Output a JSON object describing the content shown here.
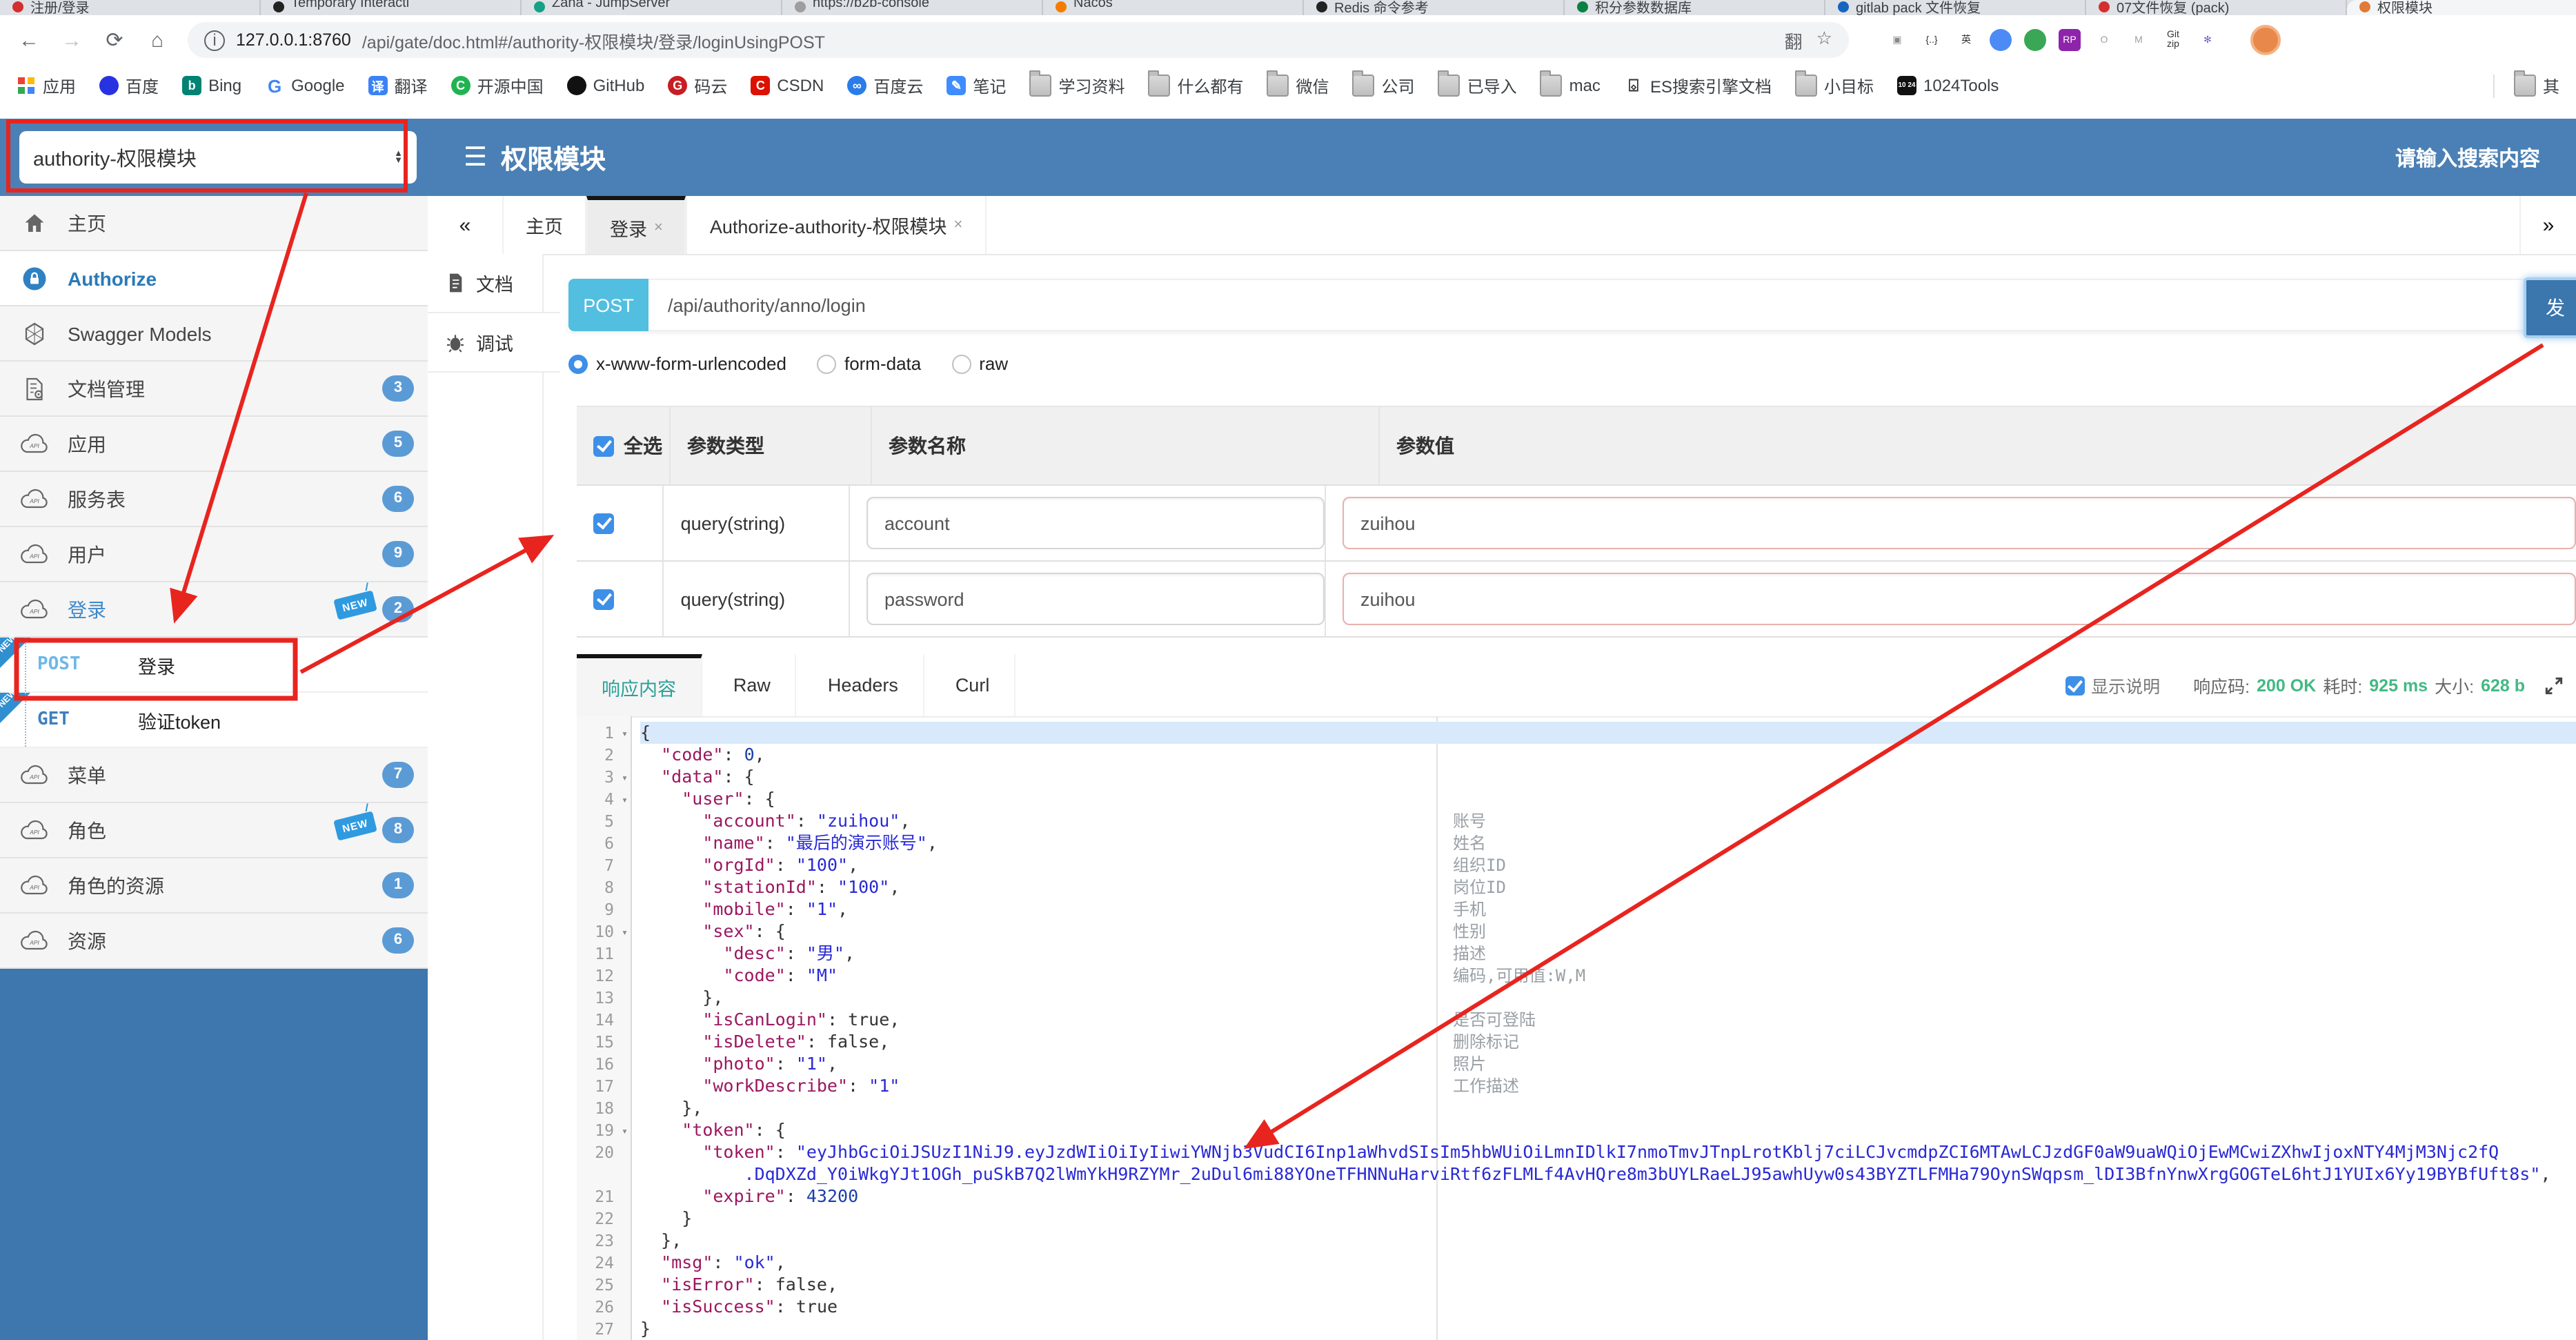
{
  "browser": {
    "tabs": [
      {
        "title": "注册/登录",
        "color": "#d32f2f"
      },
      {
        "title": "Temporary Interacti",
        "color": "#222222"
      },
      {
        "title": "Zana - JumpServer",
        "color": "#16a085"
      },
      {
        "title": "https://b2b-console",
        "color": "#9e9e9e"
      },
      {
        "title": "Nacos",
        "color": "#f57c00"
      },
      {
        "title": "Redis 命令参考",
        "color": "#222222"
      },
      {
        "title": "积分参数数据库",
        "color": "#0a8043"
      },
      {
        "title": "gitlab pack 文件恢复",
        "color": "#1565c0"
      },
      {
        "title": "07文件恢复 (pack)",
        "color": "#d32f2f"
      },
      {
        "title": "权限模块",
        "color": "#e07b39",
        "active": true
      }
    ],
    "nav": {
      "back": "←",
      "forward": "→",
      "reload": "⟳",
      "home": "⌂"
    },
    "url_host": "127.0.0.1:8760",
    "url_path": "/api/gate/doc.html#/authority-权限模块/登录/loginUsingPOST",
    "pill_icons": {
      "translate": "翻",
      "star": "☆"
    },
    "extensions": [
      {
        "name": "page-extension-icon",
        "glyph": "▣",
        "bg": "#ffffff",
        "fg": "#888888"
      },
      {
        "name": "brackets-extension-icon",
        "glyph": "{..}",
        "bg": "#ffffff",
        "fg": "#333333"
      },
      {
        "name": "translate-en-extension-icon",
        "glyph": "英",
        "bg": "#ffffff",
        "fg": "#333333"
      },
      {
        "name": "chrome-extension-icon",
        "glyph": "",
        "bg": "#4c8bf5",
        "fg": "#ffffff"
      },
      {
        "name": "globe-extension-icon",
        "glyph": "",
        "bg": "#3aa757",
        "fg": "#ffffff"
      },
      {
        "name": "rp-extension-icon",
        "glyph": "RP",
        "bg": "#8e24aa",
        "fg": "#ffffff"
      },
      {
        "name": "ring-extension-icon",
        "glyph": "O",
        "bg": "#ffffff",
        "fg": "#9e9e9e"
      },
      {
        "name": "down-arrow-extension-icon",
        "glyph": "M",
        "bg": "#ffffff",
        "fg": "#9e9e9e"
      },
      {
        "name": "gitzip-extension-icon",
        "glyph": "Git\nzip",
        "bg": "#ffffff",
        "fg": "#333333"
      },
      {
        "name": "pinwheel-extension-icon",
        "glyph": "✻",
        "bg": "#ffffff",
        "fg": "#7b61c4"
      }
    ],
    "bookmarks": [
      {
        "label": "应用",
        "icon": "grid"
      },
      {
        "label": "百度",
        "icon": "circle",
        "color": "#2932e1",
        "glyph": ""
      },
      {
        "label": "Bing",
        "icon": "square",
        "color": "#008373",
        "glyph": "b"
      },
      {
        "label": "Google",
        "icon": "glyphonly",
        "color": "#4285f4",
        "glyph": "G"
      },
      {
        "label": "翻译",
        "icon": "square",
        "color": "#3b82f6",
        "glyph": "译"
      },
      {
        "label": "开源中国",
        "icon": "circle",
        "color": "#21b352",
        "glyph": "C"
      },
      {
        "label": "GitHub",
        "icon": "circle",
        "color": "#111111",
        "glyph": ""
      },
      {
        "label": "码云",
        "icon": "circle",
        "color": "#c71d23",
        "glyph": "G"
      },
      {
        "label": "CSDN",
        "icon": "square",
        "color": "#dd1100",
        "glyph": "C"
      },
      {
        "label": "百度云",
        "icon": "circle",
        "color": "#2b7ce9",
        "glyph": "∞"
      },
      {
        "label": "笔记",
        "icon": "square",
        "color": "#3f8cff",
        "glyph": "✎"
      },
      {
        "label": "学习资料",
        "icon": "folder"
      },
      {
        "label": "什么都有",
        "icon": "folder"
      },
      {
        "label": "微信",
        "icon": "folder"
      },
      {
        "label": "公司",
        "icon": "folder"
      },
      {
        "label": "已导入",
        "icon": "folder"
      },
      {
        "label": "mac",
        "icon": "folder"
      },
      {
        "label": "ES搜索引擎文档",
        "icon": "book",
        "glyph": "⌺"
      },
      {
        "label": "小目标",
        "icon": "folder"
      },
      {
        "label": "1024Tools",
        "icon": "b1024"
      }
    ],
    "bookmarks_overflow": "其"
  },
  "header": {
    "module_select": "authority-权限模块",
    "title": "权限模块",
    "search_placeholder": "请输入搜索内容"
  },
  "sidebar": {
    "items": [
      {
        "label": "主页",
        "icon": "home"
      },
      {
        "label": "Authorize",
        "icon": "lock",
        "style": "auth"
      },
      {
        "label": "Swagger Models",
        "icon": "hex"
      },
      {
        "label": "文档管理",
        "icon": "docgear",
        "badge": "3"
      },
      {
        "label": "应用",
        "icon": "cloud",
        "badge": "5"
      },
      {
        "label": "服务表",
        "icon": "cloud",
        "badge": "6"
      },
      {
        "label": "用户",
        "icon": "cloud",
        "badge": "9"
      },
      {
        "label": "登录",
        "icon": "cloud",
        "badge": "2",
        "new": true,
        "style": "open"
      },
      {
        "method": "POST",
        "label": "登录"
      },
      {
        "method": "GET",
        "label": "验证token"
      },
      {
        "label": "菜单",
        "icon": "cloud",
        "badge": "7"
      },
      {
        "label": "角色",
        "icon": "cloud",
        "badge": "8",
        "new": true
      },
      {
        "label": "角色的资源",
        "icon": "cloud",
        "badge": "1"
      },
      {
        "label": "资源",
        "icon": "cloud",
        "badge": "6"
      }
    ]
  },
  "workspace": {
    "collapse": "«",
    "expand": "»",
    "tabs": [
      {
        "label": "主页"
      },
      {
        "label": "登录",
        "close": "×",
        "active": true
      },
      {
        "label": "Authorize-authority-权限模块",
        "close": "×"
      }
    ]
  },
  "doc_nav": {
    "doc": "文档",
    "debug": "调试"
  },
  "endpoint": {
    "method": "POST",
    "path": "/api/authority/anno/login",
    "send": "发"
  },
  "body_types": [
    {
      "label": "x-www-form-urlencoded",
      "selected": true
    },
    {
      "label": "form-data",
      "selected": false
    },
    {
      "label": "raw",
      "selected": false
    }
  ],
  "params": {
    "select_all": "全选",
    "headers": {
      "type": "参数类型",
      "name": "参数名称",
      "value": "参数值"
    },
    "rows": [
      {
        "type": "query(string)",
        "name": "account",
        "value": "zuihou"
      },
      {
        "type": "query(string)",
        "name": "password",
        "value": "zuihou"
      }
    ]
  },
  "response": {
    "tabs": [
      "响应内容",
      "Raw",
      "Headers",
      "Curl"
    ],
    "show_desc": "显示说明",
    "meta": {
      "code_label": "响应码:",
      "code": "200 OK",
      "time_label": "耗时:",
      "time": "925 ms",
      "size_label": "大小:",
      "size": "628 b"
    }
  },
  "code": {
    "lines": [
      {
        "n": 1,
        "fold": true,
        "hl": true,
        "parts": [
          [
            "p",
            "{"
          ]
        ]
      },
      {
        "n": 2,
        "parts": [
          [
            "p",
            "  "
          ],
          [
            "k",
            "\"code\""
          ],
          [
            "p",
            ": "
          ],
          [
            "n",
            "0"
          ],
          [
            "p",
            ","
          ]
        ]
      },
      {
        "n": 3,
        "fold": true,
        "parts": [
          [
            "p",
            "  "
          ],
          [
            "k",
            "\"data\""
          ],
          [
            "p",
            ": {"
          ]
        ]
      },
      {
        "n": 4,
        "fold": true,
        "parts": [
          [
            "p",
            "    "
          ],
          [
            "k",
            "\"user\""
          ],
          [
            "p",
            ": {"
          ]
        ]
      },
      {
        "n": 5,
        "ann": "账号",
        "parts": [
          [
            "p",
            "      "
          ],
          [
            "k",
            "\"account\""
          ],
          [
            "p",
            ": "
          ],
          [
            "s",
            "\"zuihou\""
          ],
          [
            "p",
            ","
          ]
        ]
      },
      {
        "n": 6,
        "ann": "姓名",
        "parts": [
          [
            "p",
            "      "
          ],
          [
            "k",
            "\"name\""
          ],
          [
            "p",
            ": "
          ],
          [
            "s",
            "\"最后的演示账号\""
          ],
          [
            "p",
            ","
          ]
        ]
      },
      {
        "n": 7,
        "ann": "组织ID",
        "parts": [
          [
            "p",
            "      "
          ],
          [
            "k",
            "\"orgId\""
          ],
          [
            "p",
            ": "
          ],
          [
            "s",
            "\"100\""
          ],
          [
            "p",
            ","
          ]
        ]
      },
      {
        "n": 8,
        "ann": "岗位ID",
        "parts": [
          [
            "p",
            "      "
          ],
          [
            "k",
            "\"stationId\""
          ],
          [
            "p",
            ": "
          ],
          [
            "s",
            "\"100\""
          ],
          [
            "p",
            ","
          ]
        ]
      },
      {
        "n": 9,
        "ann": "手机",
        "parts": [
          [
            "p",
            "      "
          ],
          [
            "k",
            "\"mobile\""
          ],
          [
            "p",
            ": "
          ],
          [
            "s",
            "\"1\""
          ],
          [
            "p",
            ","
          ]
        ]
      },
      {
        "n": 10,
        "fold": true,
        "ann": "性别",
        "parts": [
          [
            "p",
            "      "
          ],
          [
            "k",
            "\"sex\""
          ],
          [
            "p",
            ": {"
          ]
        ]
      },
      {
        "n": 11,
        "ann": "描述",
        "parts": [
          [
            "p",
            "        "
          ],
          [
            "k",
            "\"desc\""
          ],
          [
            "p",
            ": "
          ],
          [
            "s",
            "\"男\""
          ],
          [
            "p",
            ","
          ]
        ]
      },
      {
        "n": 12,
        "ann": "编码,可用值:W,M",
        "parts": [
          [
            "p",
            "        "
          ],
          [
            "k",
            "\"code\""
          ],
          [
            "p",
            ": "
          ],
          [
            "s",
            "\"M\""
          ]
        ]
      },
      {
        "n": 13,
        "parts": [
          [
            "p",
            "      },"
          ]
        ]
      },
      {
        "n": 14,
        "ann": "是否可登陆",
        "parts": [
          [
            "p",
            "      "
          ],
          [
            "k",
            "\"isCanLogin\""
          ],
          [
            "p",
            ": "
          ],
          [
            "b",
            "true"
          ],
          [
            "p",
            ","
          ]
        ]
      },
      {
        "n": 15,
        "ann": "删除标记",
        "parts": [
          [
            "p",
            "      "
          ],
          [
            "k",
            "\"isDelete\""
          ],
          [
            "p",
            ": "
          ],
          [
            "b",
            "false"
          ],
          [
            "p",
            ","
          ]
        ]
      },
      {
        "n": 16,
        "ann": "照片",
        "parts": [
          [
            "p",
            "      "
          ],
          [
            "k",
            "\"photo\""
          ],
          [
            "p",
            ": "
          ],
          [
            "s",
            "\"1\""
          ],
          [
            "p",
            ","
          ]
        ]
      },
      {
        "n": 17,
        "ann": "工作描述",
        "parts": [
          [
            "p",
            "      "
          ],
          [
            "k",
            "\"workDescribe\""
          ],
          [
            "p",
            ": "
          ],
          [
            "s",
            "\"1\""
          ]
        ]
      },
      {
        "n": 18,
        "parts": [
          [
            "p",
            "    },"
          ]
        ]
      },
      {
        "n": 19,
        "fold": true,
        "parts": [
          [
            "p",
            "    "
          ],
          [
            "k",
            "\"token\""
          ],
          [
            "p",
            ": {"
          ]
        ]
      },
      {
        "n": 20,
        "parts": [
          [
            "p",
            "      "
          ],
          [
            "k",
            "\"token\""
          ],
          [
            "p",
            ": "
          ],
          [
            "s",
            "\"eyJhbGciOiJSUzI1NiJ9.eyJzdWIiOiIyIiwiYWNjb3VudCI6Inp1aWhvdSIsIm5hbWUiOiLmnIDlkI7nmoTmvJTnpLrotKblj7ciLCJvcmdpZCI6MTAwLCJzdGF0aW9uaWQiOjEwMCwiZXhwIjoxNTY4MjM3Njc2fQ"
          ]
        ]
      },
      {
        "parts": [
          [
            "s",
            "          .DqDXZd_Y0iWkgYJt1OGh_puSkB7Q2lWmYkH9RZYMr_2uDul6mi88YOneTFHNNuHarviRtf6zFLMLf4AvHQre8m3bUYLRaeLJ95awhUyw0s43BYZTLFMHa79OynSWqpsm_lDI3BfnYnwXrgGOGTeL6htJ1YUIx6Yy19BYBfUft8s\""
          ],
          [
            "p",
            ","
          ]
        ]
      },
      {
        "n": 21,
        "parts": [
          [
            "p",
            "      "
          ],
          [
            "k",
            "\"expire\""
          ],
          [
            "p",
            ": "
          ],
          [
            "n",
            "43200"
          ]
        ]
      },
      {
        "n": 22,
        "parts": [
          [
            "p",
            "    }"
          ]
        ]
      },
      {
        "n": 23,
        "parts": [
          [
            "p",
            "  },"
          ]
        ]
      },
      {
        "n": 24,
        "parts": [
          [
            "p",
            "  "
          ],
          [
            "k",
            "\"msg\""
          ],
          [
            "p",
            ": "
          ],
          [
            "s",
            "\"ok\""
          ],
          [
            "p",
            ","
          ]
        ]
      },
      {
        "n": 25,
        "parts": [
          [
            "p",
            "  "
          ],
          [
            "k",
            "\"isError\""
          ],
          [
            "p",
            ": "
          ],
          [
            "b",
            "false"
          ],
          [
            "p",
            ","
          ]
        ]
      },
      {
        "n": 26,
        "parts": [
          [
            "p",
            "  "
          ],
          [
            "k",
            "\"isSuccess\""
          ],
          [
            "p",
            ": "
          ],
          [
            "b",
            "true"
          ]
        ]
      },
      {
        "n": 27,
        "parts": [
          [
            "p",
            "}"
          ]
        ]
      }
    ]
  },
  "colors": {
    "header_blue": "#4a80b5",
    "sidebar_blue": "#3e76ae",
    "badge_blue": "#5b9bd5",
    "post_badge": "#52bfe0",
    "send_button": "#3b76ad",
    "active_tab_teal": "#2aa198",
    "meta_green": "#42b983",
    "annotation_red": "#e8241f",
    "key": "#9b175f",
    "string": "#2929d6"
  }
}
